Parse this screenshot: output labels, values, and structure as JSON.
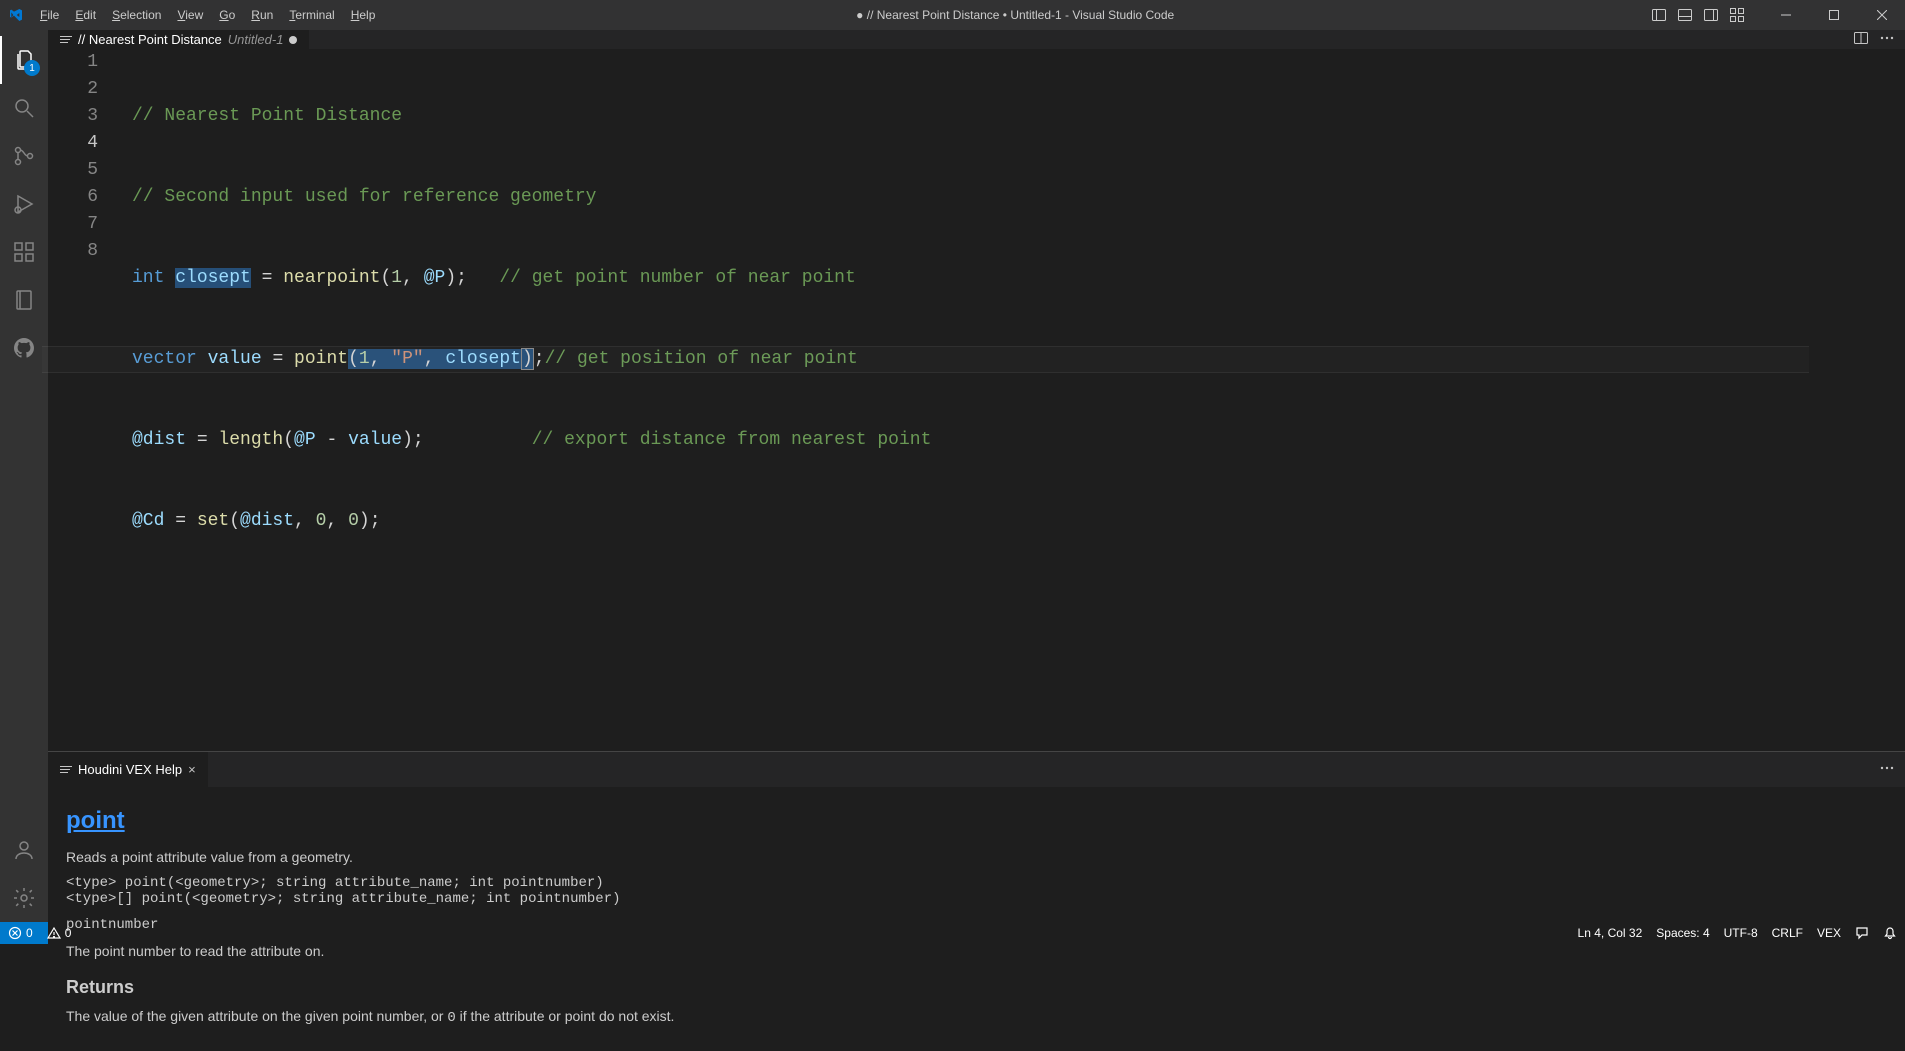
{
  "menubar": {
    "file": "File",
    "edit": "Edit",
    "selection": "Selection",
    "view": "View",
    "go": "Go",
    "run": "Run",
    "terminal": "Terminal",
    "help": "Help"
  },
  "title": "● // Nearest Point Distance • Untitled-1 - Visual Studio Code",
  "activity": {
    "explorer_badge": "1"
  },
  "editor_tab": {
    "label": "// Nearest Point Distance",
    "detail": "Untitled-1"
  },
  "code": {
    "line1": {
      "comment": "// Nearest Point Distance"
    },
    "line2": {
      "comment": "// Second input used for reference geometry"
    },
    "line3": {
      "kw": "int",
      "var": "closept",
      "eq": " = ",
      "fn": "nearpoint",
      "lp": "(",
      "n1": "1",
      "c1": ", ",
      "at": "@P",
      "rp": ");",
      "cmt": "// get point number of near point"
    },
    "line4": {
      "kw": "vector",
      "var": "value",
      "eq": " = ",
      "fn": "point",
      "lp": "(",
      "n1": "1",
      "c1": ", ",
      "str": "\"P\"",
      "c2": ", ",
      "arg3": "closept",
      "rp": ")",
      "semi": ";",
      "cmt": "// get position of near point"
    },
    "line5": {
      "attr": "@dist",
      "eq": " = ",
      "fn": "length",
      "lp": "(",
      "a1": "@P",
      "op": " - ",
      "a2": "value",
      "rp": ");",
      "cmt": "// export distance from nearest point"
    },
    "line6": {
      "attr": "@Cd",
      "eq": " = ",
      "fn": "set",
      "lp": "(",
      "a1": "@dist",
      "c1": ", ",
      "n1": "0",
      "c2": ", ",
      "n2": "0",
      "rp": ");"
    }
  },
  "line_numbers": [
    "1",
    "2",
    "3",
    "4",
    "5",
    "6",
    "7",
    "8"
  ],
  "panel": {
    "tab_label": "Houdini VEX Help"
  },
  "help": {
    "title": "point",
    "summary": "Reads a point attribute value from a geometry.",
    "sig1": "<type> point(<geometry>; string attribute_name; int pointnumber)",
    "sig2": "<type>[] point(<geometry>; string attribute_name; int pointnumber)",
    "param_name": "pointnumber",
    "param_desc": "The point number to read the attribute on.",
    "returns_heading": "Returns",
    "returns_body_a": "The value of the given attribute on the given point number, or ",
    "returns_zero": "0",
    "returns_body_b": " if the attribute or point do not exist."
  },
  "status": {
    "errors": "0",
    "warnings": "0",
    "ln_col": "Ln 4, Col 32",
    "spaces": "Spaces: 4",
    "encoding": "UTF-8",
    "eol": "CRLF",
    "lang": "VEX"
  }
}
